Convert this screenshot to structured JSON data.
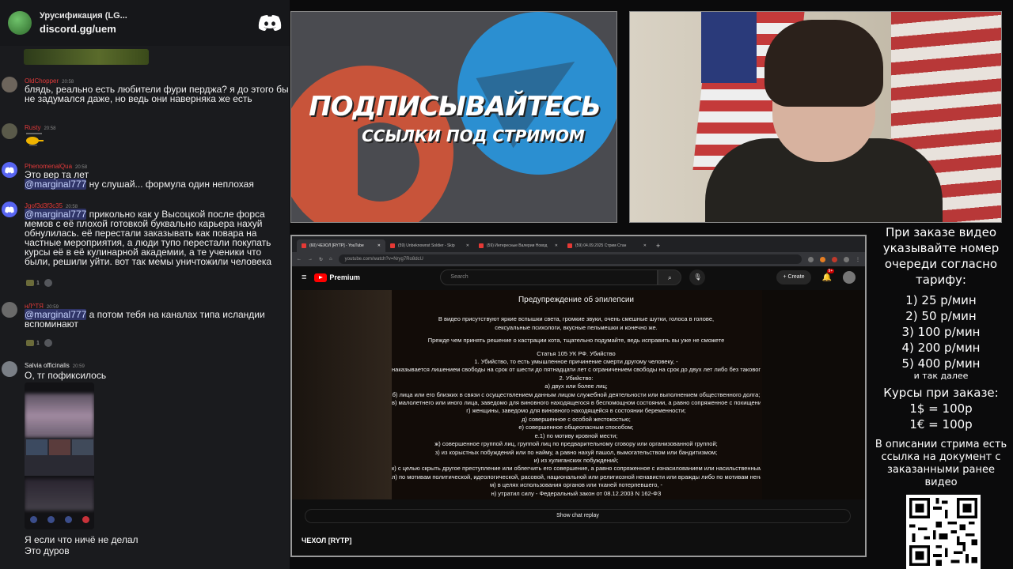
{
  "chat": {
    "server_name": "Урусификация (LG...",
    "server_invite": "discord.gg/uem",
    "messages": [
      {
        "user": "OldChopper",
        "time": "20:58",
        "text": "блядь, реально есть любители фури перджа? я до этого бы не задумался даже, но ведь они наверняка же есть"
      },
      {
        "user": "Rusty",
        "time": "20:58"
      },
      {
        "user": "PhenomenalQua",
        "time": "20:58",
        "line1": "Это вер та лет",
        "mention": "@marginal777",
        "text": " ну слушай... формула один неплохая"
      },
      {
        "user": "Jgof3d3f3c35",
        "time": "20:58",
        "mention": "@marginal777",
        "text": " прикольно как у Высоцкой после форса мемов с её плохой готовкой буквально карьера нахуй обнулилась. её перестали заказывать как повара на частные мероприятия, а люди тупо перестали покупать курсы её в её кулинарной академии, а те ученики что были, решили уйти. вот так мемы уничтожили человека",
        "reaction_count": "1"
      },
      {
        "user": "нЛ^ТЯ",
        "time": "20:59",
        "mention": "@marginal777",
        "text": " а потом тебя на каналах типа исландии вспоминают",
        "reaction_count": "1"
      },
      {
        "user": "Salvia officinalis",
        "time": "20:59",
        "text": "О, тг пофиксилось"
      },
      {
        "text": "Я если что ничё не делал"
      },
      {
        "text": "Это дуров"
      }
    ]
  },
  "promo": {
    "title": "ПОДПИСЫВАЙТЕСЬ",
    "subtitle": "ССЫЛКИ ПОД СТРИМОМ"
  },
  "browser": {
    "tabs": [
      {
        "label": "(60) ЧЕХОЛ [RYTP] - YouTube",
        "active": true
      },
      {
        "label": "(59) Unbeknownst Soldier - Skip",
        "active": false
      },
      {
        "label": "(59) Интересные Валерии Новод",
        "active": false
      },
      {
        "label": "(59) 04.09.2025 Стрим Стан",
        "active": false
      }
    ],
    "url": "youtube.com/watch?v=Nryg7Ro8dcU",
    "youtube": {
      "brand": "Premium",
      "search_placeholder": "Search",
      "create_label": "Create",
      "notif_count": "9+",
      "chat_replay_label": "Show chat replay",
      "video_title": "ЧЕХОЛ [RYTP]"
    },
    "video_lines": [
      "Предупреждение об эпилепсии",
      "",
      "В видео присутствуют яркие вспышки света, громкие звуки, очень смешные шутки, голоса в голове,",
      "сексуальные психологи, вкусные пельмешки и конечно же.",
      "",
      "Прежде чем принять решение о кастрации кота, тщательно подумайте, ведь исправить вы уже не сможете",
      "",
      "Статья 105 УК РФ. Убийство",
      "1. Убийство, то есть умышленное причинение смерти другому человеку, -",
      "наказывается лишением свободы на срок от шести до пятнадцати лет с ограничением свободы на срок до двух лет либо без такового.",
      "2. Убийство:",
      "а) двух или более лиц;",
      "б) лица или его близких в связи с осуществлением данным лицом служебной деятельности или выполнением общественного долга;",
      "в) малолетнего или иного лица, заведомо для виновного находящегося в беспомощном состоянии, а равно сопряженное с похищением человека;",
      "г) женщины, заведомо для виновного находящейся в состоянии беременности;",
      "д) совершенное с особой жестокостью;",
      "е) совершенное общеопасным способом;",
      "е.1) по мотиву кровной мести;",
      "ж) совершенное группой лиц, группой лиц по предварительному сговору или организованной группой;",
      "з) из корыстных побуждений или по найму, а равно нахуй пашол, вымогательством или бандитизмом;",
      "и) из хулиганских побуждений;",
      "к) с целью скрыть другое преступление или облегчить его совершение, а равно сопряженное с изнасилованием или насильственными действиями сексуального характера;",
      "л) по мотивам политической, идеологической, расовой, национальной или религиозной ненависти или вражды либо по мотивам ненависти или вражды в отношении какой-либо социальной группы;",
      "м) в целях использования органов или тканей потерпевшего, -",
      "н) утратил силу - Федеральный закон от 08.12.2003 N 162-ФЗ"
    ]
  },
  "prices": {
    "intro": "При заказе видео указывайте номер очереди согласно тарифу:",
    "tiers": [
      "1) 25 р/мин",
      "2) 50 р/мин",
      "3) 100 р/мин",
      "4) 200 р/мин",
      "5) 400 р/мин"
    ],
    "etc": "и так далее",
    "courses_title": "Курсы при заказе:",
    "rates": [
      "1$ = 100р",
      "1€ = 100р"
    ],
    "note": "В описании стрима есть ссылка на документ с заказанными ранее видео"
  }
}
